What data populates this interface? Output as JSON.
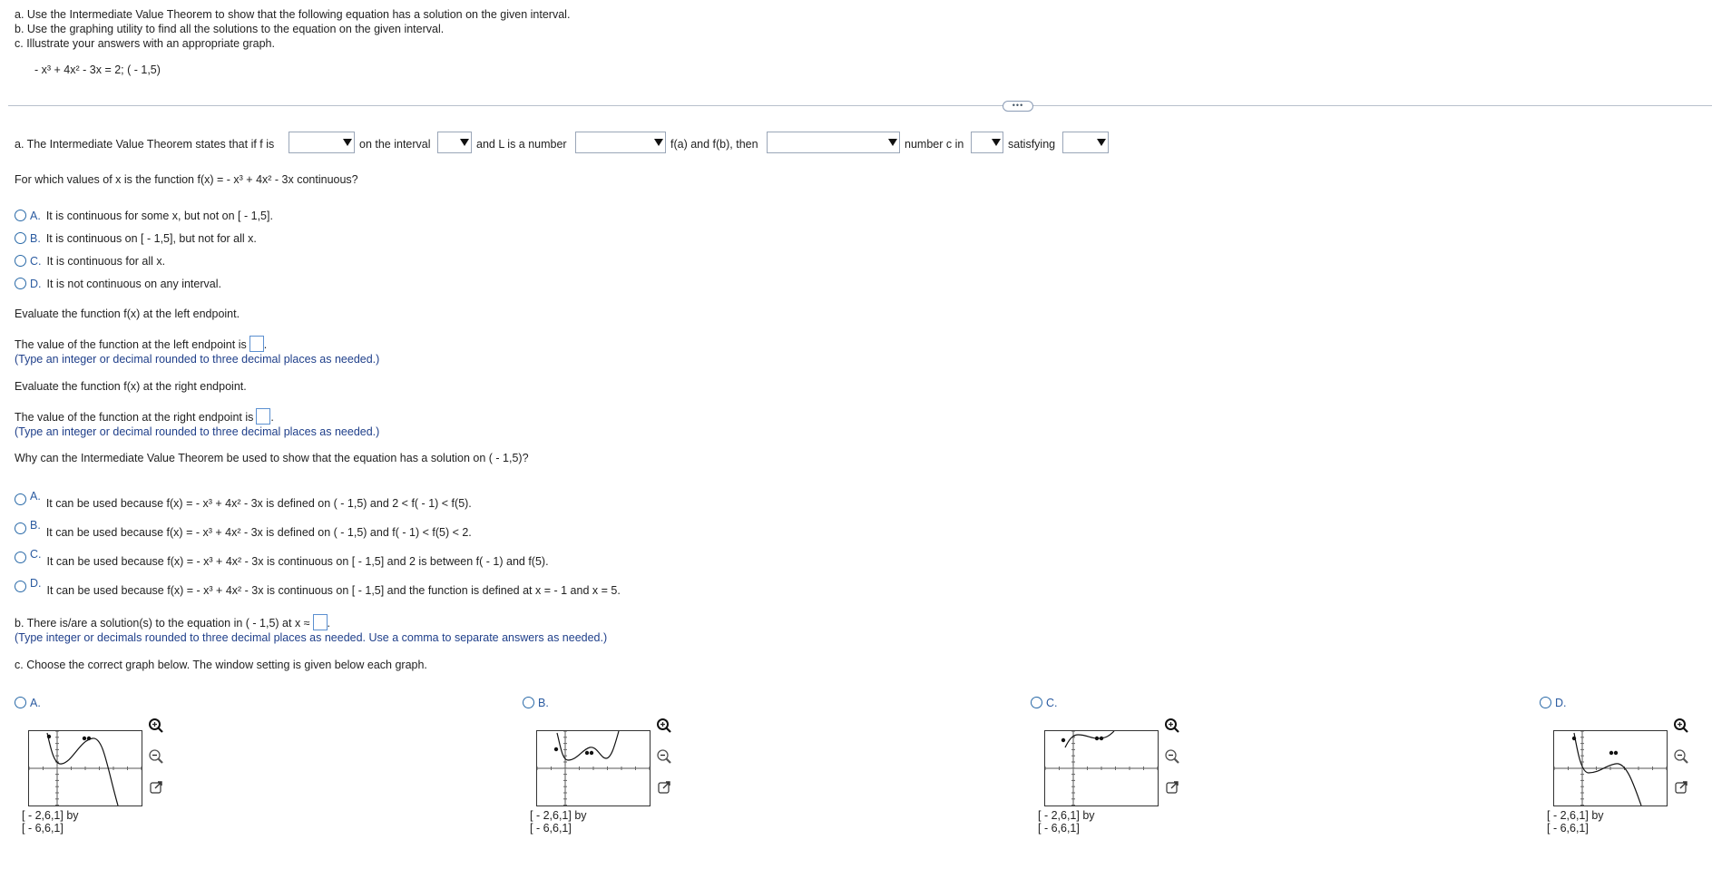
{
  "intro": {
    "line_a": "a. Use the Intermediate Value Theorem to show that the following equation has a solution on the given interval.",
    "line_b": "b. Use the graphing utility to find all the solutions to the equation on the given interval.",
    "line_c": "c. Illustrate your answers with an appropriate graph.",
    "equation": "- x³ + 4x² - 3x = 2; ( - 1,5)"
  },
  "divider": {
    "expand_label": "•••"
  },
  "part_a": {
    "ivt": {
      "t1": "a. The Intermediate Value Theorem states that if f is",
      "t2": "on the interval",
      "t3": "and L is a number",
      "t4": "f(a) and f(b), then",
      "t5": "number c in",
      "t6": "satisfying"
    },
    "continuity_question": "For which values of x is the function f(x) = - x³ + 4x² - 3x continuous?",
    "continuity_options": [
      {
        "letter": "A.",
        "text": "It is continuous for some x, but not on [ - 1,5]."
      },
      {
        "letter": "B.",
        "text": "It is continuous on [ - 1,5], but not for all x."
      },
      {
        "letter": "C.",
        "text": "It is continuous for all x."
      },
      {
        "letter": "D.",
        "text": "It is not continuous on any interval."
      }
    ],
    "eval_left_prompt": "Evaluate the function f(x) at the left endpoint.",
    "eval_left_label": "The value of the function at the left endpoint is",
    "eval_left_hint": "(Type an integer or decimal rounded to three decimal places as needed.)",
    "eval_right_prompt": "Evaluate the function f(x) at the right endpoint.",
    "eval_right_label": "The value of the function at the right endpoint is",
    "eval_right_hint": "(Type an integer or decimal rounded to three decimal places as needed.)",
    "why_question": "Why can the Intermediate Value Theorem be used to show that the equation has a solution on ( - 1,5)?",
    "why_options": [
      {
        "letter": "A.",
        "text": "It can be used because f(x) = - x³ + 4x² - 3x is defined on ( - 1,5) and 2 < f( - 1) < f(5)."
      },
      {
        "letter": "B.",
        "text": "It can be used because f(x) = - x³ + 4x² - 3x is defined on ( - 1,5) and f( - 1) < f(5) < 2."
      },
      {
        "letter": "C.",
        "text": "It can be used because f(x) = - x³ + 4x² - 3x is continuous on [ - 1,5] and 2 is between f( - 1) and f(5)."
      },
      {
        "letter": "D.",
        "text": "It can be used because f(x) = - x³ + 4x² - 3x is continuous on [ - 1,5] and the function is defined at x = - 1 and x = 5."
      }
    ]
  },
  "part_b": {
    "label": "b. There is/are a solution(s) to the equation in ( - 1,5) at x ≈",
    "hint": "(Type integer or decimals rounded to three decimal places as needed. Use a comma to separate answers as needed.)"
  },
  "part_c": {
    "prompt": "c. Choose the correct graph below. The window setting is given below each graph.",
    "graphs": [
      {
        "letter": "A.",
        "window_x": "[ - 2,6,1] by",
        "window_y": "[ - 6,6,1]"
      },
      {
        "letter": "B.",
        "window_x": "[ - 2,6,1] by",
        "window_y": "[ - 6,6,1]"
      },
      {
        "letter": "C.",
        "window_x": "[ - 2,6,1] by",
        "window_y": "[ - 6,6,1]"
      },
      {
        "letter": "D.",
        "window_x": "[ - 2,6,1] by",
        "window_y": "[ - 6,6,1]"
      }
    ]
  },
  "icons": [
    "zoom-in-icon",
    "zoom-out-icon",
    "open-external-icon",
    "dropdown-arrow-icon"
  ],
  "colors": {
    "accent_blue": "#1f3f8a",
    "radio_blue": "#2a6aa8",
    "input_border": "#5b8fd0"
  }
}
